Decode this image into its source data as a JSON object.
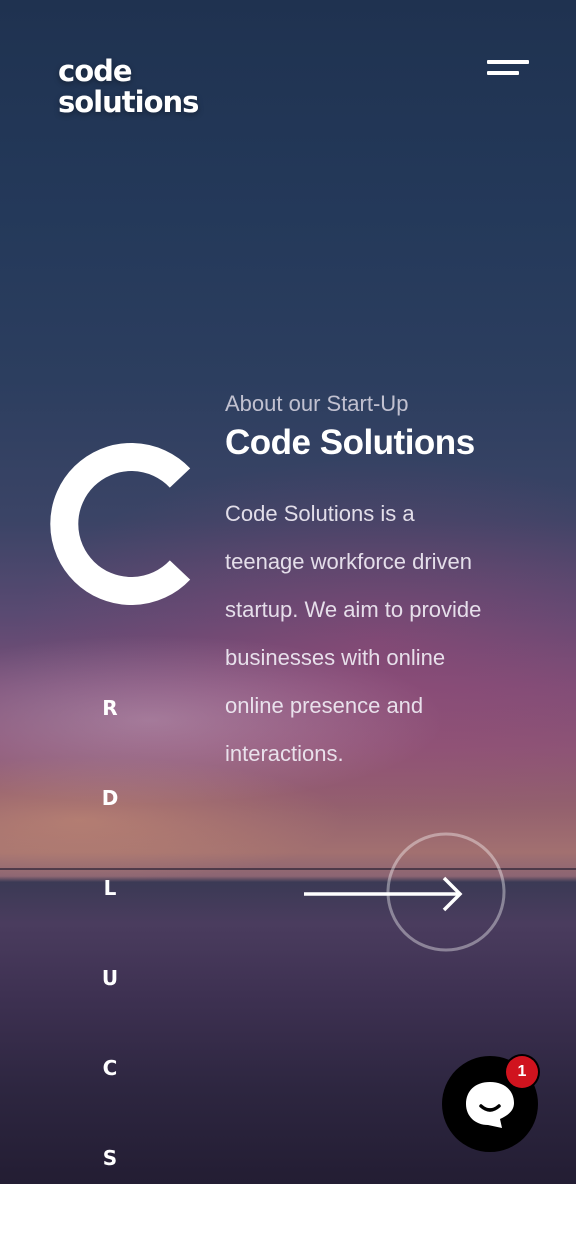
{
  "brand": {
    "line1": "code",
    "line2": "solutions"
  },
  "menu": {
    "icon": "hamburger-menu-icon"
  },
  "hero": {
    "monogram": "C",
    "eyebrow": "About our Start-Up",
    "title": "Code Solutions",
    "description": [
      "Code Solutions is a",
      "teenage workforce driven",
      "startup. We aim to provide",
      "businesses with online",
      "online presence and",
      "interactions."
    ]
  },
  "side_letters": [
    "R",
    "D",
    "L",
    "U",
    "C",
    "S"
  ],
  "next_button": {
    "icon": "arrow-right-icon"
  },
  "chat": {
    "icon": "chat-bubble-icon",
    "badge_count": "1"
  }
}
